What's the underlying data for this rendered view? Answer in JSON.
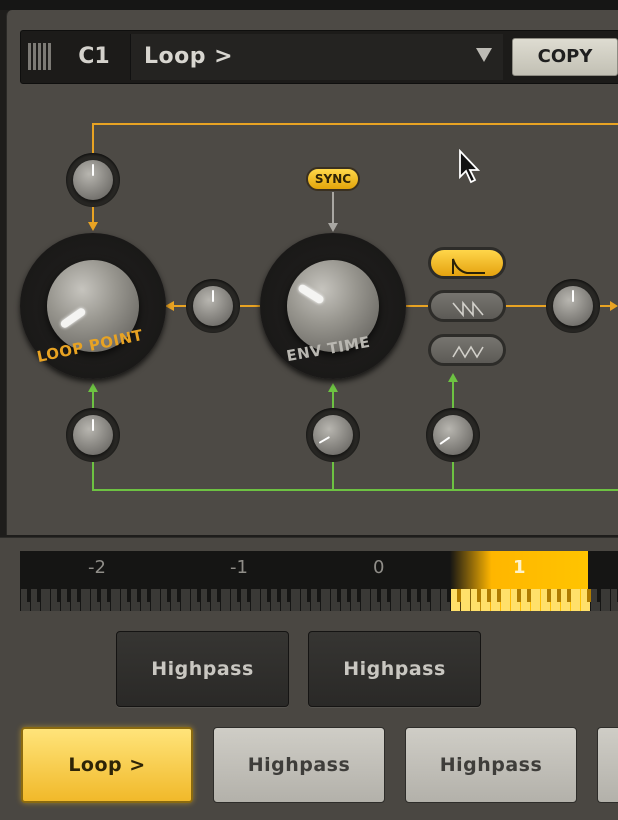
{
  "header": {
    "note": "C1",
    "preset_name": "Loop >",
    "copy_label": "COPY"
  },
  "modulation": {
    "sync_label": "SYNC",
    "loop_point_label": "LOOP POINT",
    "env_time_label": "ENV TIME",
    "waveforms": [
      "decay-shape-icon",
      "saw-shape-icon",
      "triangle-shape-icon"
    ],
    "active_waveform_index": 0
  },
  "colors": {
    "accent_orange": "#e8a323",
    "mod_green": "#6dc242",
    "active_gold": "#ffc400"
  },
  "octave_bar": {
    "labels": [
      "-2",
      "-1",
      "0",
      "1"
    ],
    "active_label": "1"
  },
  "buttons": {
    "row1": [
      "Highpass",
      "Highpass"
    ],
    "row2": [
      "Loop >",
      "Highpass",
      "Highpass"
    ],
    "row2_active_index": 0
  }
}
